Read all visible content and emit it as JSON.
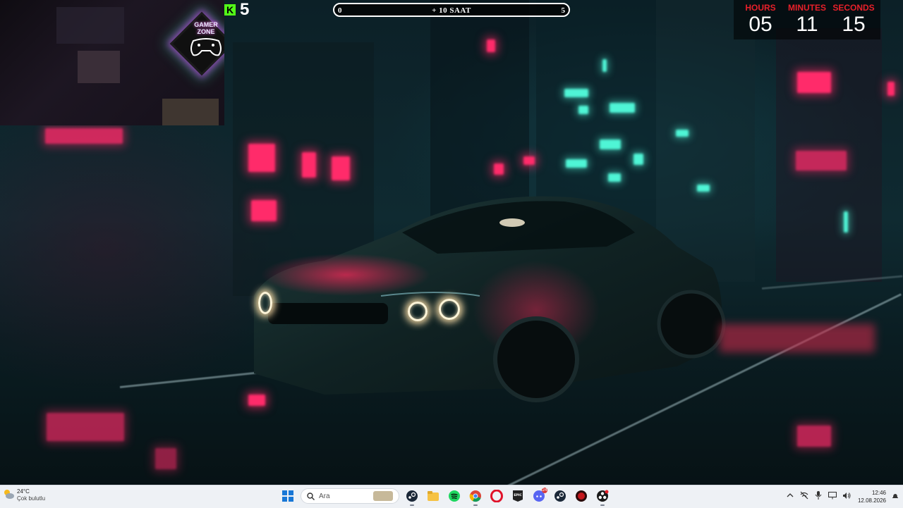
{
  "webcam": {
    "badge_line1": "GAMER",
    "badge_line2": "ZONE"
  },
  "kick": {
    "count": "5",
    "logo": "K"
  },
  "subathon": {
    "min": "0",
    "label": "+ 10 SAAT",
    "max": "5",
    "progress": 0.0
  },
  "countdown": {
    "hours_label": "HOURS",
    "hours": "05",
    "minutes_label": "MINUTES",
    "minutes": "11",
    "seconds_label": "SECONDS",
    "seconds": "15",
    "accent_color": "#e8202a"
  },
  "taskbar": {
    "weather": {
      "temp": "24°C",
      "desc": "Çok bulutlu",
      "icon": "partly-cloudy-icon"
    },
    "search_placeholder": "Ara",
    "apps": [
      {
        "name": "windows-start-icon"
      },
      {
        "name": "search-icon"
      },
      {
        "name": "steam-icon"
      },
      {
        "name": "file-explorer-icon"
      },
      {
        "name": "spotify-icon"
      },
      {
        "name": "chrome-icon"
      },
      {
        "name": "opera-icon"
      },
      {
        "name": "epic-games-icon",
        "label": "EPIC"
      },
      {
        "name": "discord-icon",
        "badge": "24"
      },
      {
        "name": "steam-icon-2"
      },
      {
        "name": "app-red-icon"
      },
      {
        "name": "obs-icon"
      }
    ],
    "tray": [
      "chevron-up-icon",
      "network-off-icon",
      "microphone-icon",
      "display-icon",
      "volume-icon"
    ],
    "time": "12:46",
    "date": "12.08.2026"
  }
}
